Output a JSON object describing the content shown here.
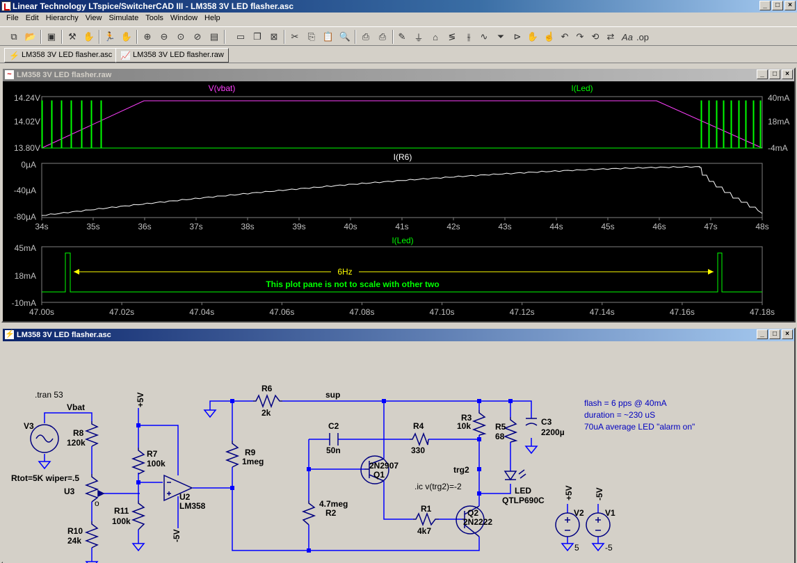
{
  "window": {
    "title": "Linear Technology LTspice/SwitcherCAD III - LM358 3V LED flasher.asc",
    "min": "_",
    "max": "□",
    "close": "×"
  },
  "menu": [
    "File",
    "Edit",
    "Hierarchy",
    "View",
    "Simulate",
    "Tools",
    "Window",
    "Help"
  ],
  "toolbar_icons": [
    "open-schematic-icon",
    "open-file-icon",
    "save-icon",
    "hammer-icon",
    "hand-pan-icon",
    "run-icon",
    "halt-icon",
    "zoom-in-icon",
    "zoom-out-icon",
    "zoom-fit-icon",
    "zoom-back-icon",
    "autorange-icon",
    "tile-vertical-icon",
    "cascade-icon",
    "close-window-icon",
    "cut-icon",
    "copy-icon",
    "paste-icon",
    "find-icon",
    "print-setup-icon",
    "print-icon",
    "draw-wire-icon",
    "ground-icon",
    "label-net-icon",
    "resistor-icon",
    "capacitor-icon",
    "inductor-icon",
    "diode-icon",
    "component-icon",
    "move-icon",
    "drag-icon",
    "undo-icon",
    "redo-icon",
    "rotate-icon",
    "mirror-icon",
    "text-icon",
    "spice-directive-icon"
  ],
  "tabs": [
    {
      "label": "LM358 3V LED flasher.asc",
      "icon": "schematic-icon"
    },
    {
      "label": "LM358 3V LED flasher.raw",
      "icon": "waveform-icon"
    }
  ],
  "waveform_window": {
    "title": "LM358 3V LED flasher.raw",
    "pane1": {
      "traces": [
        {
          "name": "V(vbat)",
          "color": "#ff40ff"
        },
        {
          "name": "I(Led)",
          "color": "#00ff00"
        }
      ],
      "left_ticks": [
        "14.24V",
        "14.02V",
        "13.80V"
      ],
      "right_ticks": [
        "40mA",
        "18mA",
        "-4mA"
      ]
    },
    "pane2": {
      "trace": {
        "name": "I(R6)",
        "color": "#ffffff"
      },
      "left_ticks": [
        "0µA",
        "-40µA",
        "-80µA"
      ],
      "x_ticks": [
        "34s",
        "35s",
        "36s",
        "37s",
        "38s",
        "39s",
        "40s",
        "41s",
        "42s",
        "43s",
        "44s",
        "45s",
        "46s",
        "47s",
        "48s"
      ]
    },
    "pane3": {
      "trace": {
        "name": "I(Led)",
        "color": "#00ff00"
      },
      "left_ticks": [
        "45mA",
        "18mA",
        "-10mA"
      ],
      "x_ticks": [
        "47.00s",
        "47.02s",
        "47.04s",
        "47.06s",
        "47.08s",
        "47.10s",
        "47.12s",
        "47.14s",
        "47.16s",
        "47.18s"
      ],
      "annotation_freq": "6Hz",
      "annotation_note": "This plot pane is not to scale with other two"
    }
  },
  "schematic_window": {
    "title": "LM358 3V LED flasher.asc",
    "directives": [
      ".tran 53",
      ".ic v(trg2)=-2"
    ],
    "notes": [
      "flash = 6 pps @ 40mA",
      "duration = ~230 uS",
      "70uA average LED \"alarm on\""
    ],
    "labels": {
      "vbat": "Vbat",
      "rtot": "Rtot=5K wiper=.5",
      "u3": "U3",
      "o": "o",
      "sup": "sup",
      "trg2": "trg2",
      "plus5v": "+5V",
      "minus5v": "-5V",
      "v2_val": "5",
      "v1_val": "-5"
    },
    "components": {
      "V3": {
        "ref": "V3"
      },
      "R8": {
        "ref": "R8",
        "value": "120k"
      },
      "R10": {
        "ref": "R10",
        "value": "24k"
      },
      "R7": {
        "ref": "R7",
        "value": "100k"
      },
      "R11": {
        "ref": "R11",
        "value": "100k"
      },
      "U2": {
        "ref": "U2",
        "value": "LM358"
      },
      "R6": {
        "ref": "R6",
        "value": "2k"
      },
      "R9": {
        "ref": "R9",
        "value": "1meg"
      },
      "C2": {
        "ref": "C2",
        "value": "50n"
      },
      "R4": {
        "ref": "R4",
        "value": "330"
      },
      "R2": {
        "ref": "R2",
        "value": "4.7meg"
      },
      "Q1": {
        "ref": "Q1",
        "value": "2N2907"
      },
      "R1": {
        "ref": "R1",
        "value": "4k7"
      },
      "Q2": {
        "ref": "Q2",
        "value": "2N2222"
      },
      "R3": {
        "ref": "R3",
        "value": "10k"
      },
      "R5": {
        "ref": "R5",
        "value": "68"
      },
      "C3": {
        "ref": "C3",
        "value": "2200µ"
      },
      "LED": {
        "ref": "LED",
        "value": "QTLP690C"
      },
      "V2": {
        "ref": "V2"
      },
      "V1": {
        "ref": "V1"
      }
    }
  },
  "colors": {
    "wave_bg": "#000000",
    "grid": "#808080",
    "vbat": "#ff40ff",
    "led": "#00ff00",
    "ir6": "#ffffff",
    "annot": "#ffff00",
    "wire": "#0000ff",
    "symbol": "#000080",
    "schem_bg": "#d4d0c8",
    "note": "#0000c0"
  }
}
